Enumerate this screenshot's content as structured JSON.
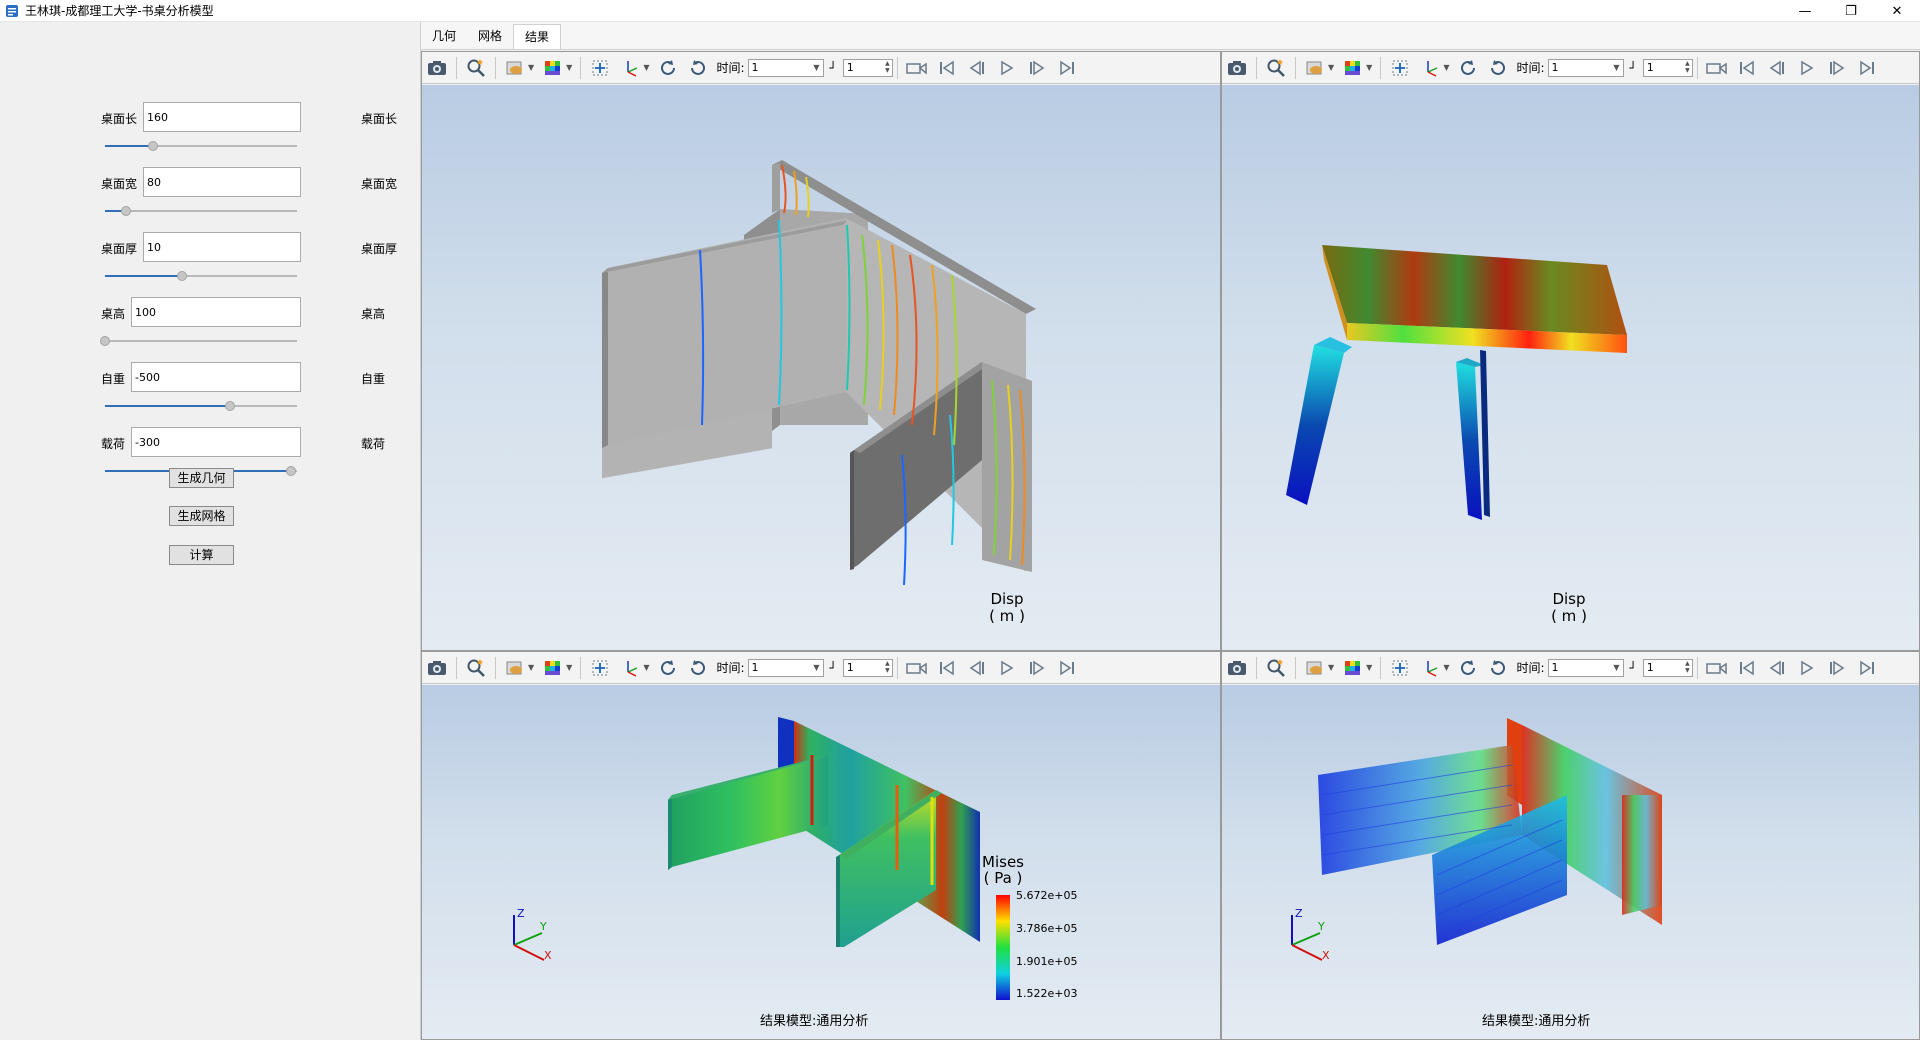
{
  "window": {
    "title": "王林琪-成都理工大学-书桌分析模型",
    "controls": [
      "—",
      "❐",
      "✕"
    ]
  },
  "params": [
    {
      "label": "桌面长",
      "value": "160",
      "right_label": "桌面长",
      "slider": 0.25
    },
    {
      "label": "桌面宽",
      "value": "80",
      "right_label": "桌面宽",
      "slider": 0.11
    },
    {
      "label": "桌面厚",
      "value": "10",
      "right_label": "桌面厚",
      "slider": 0.4
    },
    {
      "label": "桌高",
      "value": "100",
      "right_label": "桌高",
      "slider": 0.0
    },
    {
      "label": "自重",
      "value": "-500",
      "right_label": "自重",
      "slider": 0.65
    },
    {
      "label": "载荷",
      "value": "-300",
      "right_label": "载荷",
      "slider": 0.97
    }
  ],
  "buttons": {
    "gen_geom": "生成几何",
    "gen_mesh": "生成网格",
    "compute": "计算"
  },
  "tabs": [
    "几何",
    "网格",
    "结果"
  ],
  "active_tab": "结果",
  "toolbar": {
    "time_label": "时间:",
    "time_value": "1",
    "step_value": "1"
  },
  "viewports": {
    "top_left": {
      "legend_title": "Disp",
      "legend_unit": "( m )"
    },
    "top_right": {
      "legend_title": "Disp",
      "legend_unit": "( m )"
    },
    "bottom_left": {
      "legend_title": "Mises",
      "legend_unit": "( Pa )",
      "legend_values": [
        "5.672e+05",
        "3.786e+05",
        "1.901e+05",
        "1.522e+03"
      ],
      "caption": "结果模型:通用分析",
      "axes": [
        "Z",
        "Y",
        "X"
      ]
    },
    "bottom_right": {
      "caption": "结果模型:通用分析",
      "axes": [
        "Z",
        "Y",
        "X"
      ]
    }
  },
  "colors": {
    "accent": "#2f6fb8",
    "canvas_top": "#b9cce3",
    "canvas_bottom": "#e4ebf2"
  }
}
